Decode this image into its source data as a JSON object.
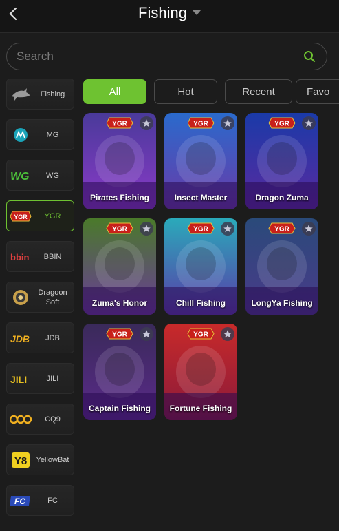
{
  "header": {
    "title": "Fishing"
  },
  "search": {
    "placeholder": "Search"
  },
  "providers": [
    {
      "label": "Fishing",
      "icon": "shark-icon"
    },
    {
      "label": "MG",
      "icon": "mg-logo"
    },
    {
      "label": "WG",
      "icon": "wg-logo"
    },
    {
      "label": "YGR",
      "icon": "ygr-logo",
      "active": true
    },
    {
      "label": "BBIN",
      "icon": "bbin-logo"
    },
    {
      "label": "Dragoon Soft",
      "icon": "dragoon-soft-logo"
    },
    {
      "label": "JDB",
      "icon": "jdb-logo"
    },
    {
      "label": "JILI",
      "icon": "jili-logo"
    },
    {
      "label": "CQ9",
      "icon": "cq9-logo"
    },
    {
      "label": "YellowBat",
      "icon": "yellowbat-logo"
    },
    {
      "label": "FC",
      "icon": "fc-logo"
    }
  ],
  "tabs": [
    {
      "label": "All",
      "active": true
    },
    {
      "label": "Hot"
    },
    {
      "label": "Recent"
    },
    {
      "label": "Favo"
    }
  ],
  "games": [
    {
      "title": "Pirates Fishing",
      "badge": "YGR",
      "colors": [
        "#4a3a9a",
        "#8a3ac8"
      ]
    },
    {
      "title": "Insect Master",
      "badge": "YGR",
      "colors": [
        "#2a6acc",
        "#6a3aa8"
      ]
    },
    {
      "title": "Dragon Zuma",
      "badge": "YGR",
      "colors": [
        "#1a3aa8",
        "#5a2aa0"
      ]
    },
    {
      "title": "Zuma's Honor",
      "badge": "YGR",
      "colors": [
        "#4a7a2a",
        "#6a3a9a"
      ]
    },
    {
      "title": "Chill Fishing",
      "badge": "YGR",
      "colors": [
        "#2aaaba",
        "#5a3aa8"
      ]
    },
    {
      "title": "LongYa Fishing",
      "badge": "YGR",
      "colors": [
        "#2a4a7a",
        "#4a3a8a"
      ]
    },
    {
      "title": "Captain Fishing",
      "badge": "YGR",
      "colors": [
        "#3a2a5a",
        "#5a2a8a"
      ]
    },
    {
      "title": "Fortune Fishing",
      "badge": "YGR",
      "colors": [
        "#c82a2a",
        "#8a1a3a"
      ]
    }
  ],
  "colors": {
    "accent": "#6ec231",
    "background": "#1c1c1c"
  }
}
